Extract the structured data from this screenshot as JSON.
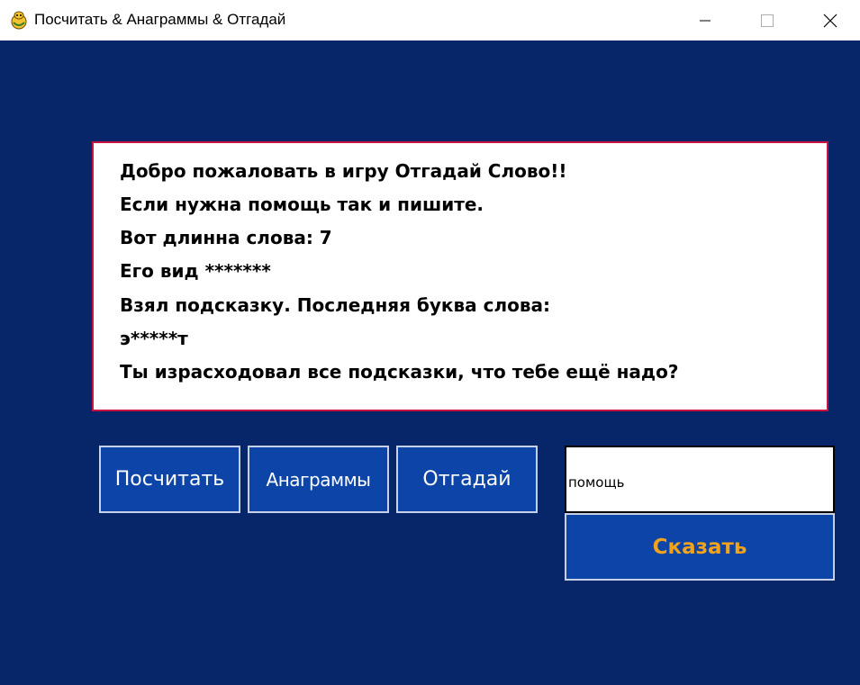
{
  "window": {
    "title": "Посчитать & Анаграммы & Отгадай",
    "app_icon": "pygame-snake-icon",
    "controls": {
      "minimize_icon": "minimize-icon",
      "maximize_icon": "maximize-icon",
      "close_icon": "close-icon"
    }
  },
  "colors": {
    "background": "#062669",
    "message_border": "#c8143c",
    "button_fill": "#0c44a8",
    "button_border": "#c6d0e6",
    "say_label": "#f2a21b"
  },
  "messages": [
    "Добро пожаловать в игру Отгадай Слово!!",
    "Если нужна помощь так и пишите.",
    "Вот длинна слова: 7",
    "Его вид *******",
    "Взял подсказку. Последняя буква слова:",
    "э*****т",
    "Ты израсходовал все подсказки, что тебе ещё надо?"
  ],
  "buttons": {
    "count": "Посчитать",
    "anagrams": "Анаграммы",
    "guess": "Отгадай",
    "say": "Сказать"
  },
  "input": {
    "value": "помощь"
  }
}
